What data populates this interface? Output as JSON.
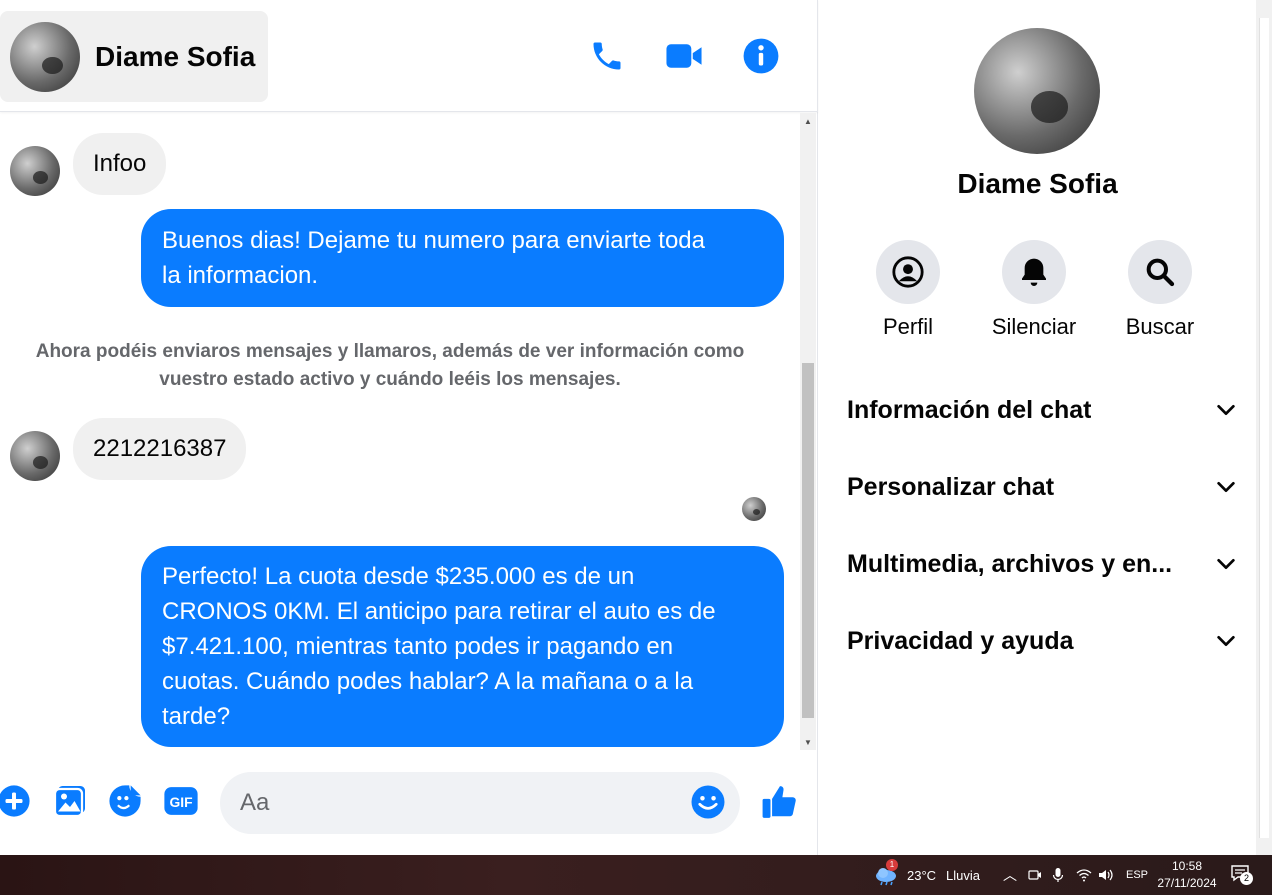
{
  "contact": {
    "name": "Diame Sofia"
  },
  "messages": [
    {
      "direction": "in",
      "text": "Infoo"
    },
    {
      "direction": "out",
      "lines": [
        "Buenos dias! Dejame tu numero para enviarte toda",
        "la informacion."
      ]
    },
    {
      "direction": "system",
      "lines": [
        "Ahora podéis enviaros mensajes y llamaros, además de ver información como",
        "vuestro estado activo y cuándo leéis los mensajes."
      ]
    },
    {
      "direction": "in",
      "text": "2212216387"
    },
    {
      "direction": "out",
      "lines": [
        "Perfecto! La cuota desde $235.000 es de un",
        "CRONOS 0KM. El anticipo para retirar el auto es de",
        "$7.421.100, mientras tanto podes ir pagando en",
        "cuotas. Cuándo podes hablar? A la mañana o a la",
        "tarde?"
      ]
    }
  ],
  "composer": {
    "placeholder": "Aa",
    "value": ""
  },
  "info": {
    "name": "Diame Sofia",
    "actions": [
      {
        "label": "Perfil"
      },
      {
        "label": "Silenciar"
      },
      {
        "label": "Buscar"
      }
    ],
    "sections": [
      {
        "label": "Información del chat"
      },
      {
        "label": "Personalizar chat"
      },
      {
        "label": "Multimedia, archivos y en..."
      },
      {
        "label": "Privacidad y ayuda"
      }
    ]
  },
  "taskbar": {
    "weather": {
      "temp": "23°C",
      "condition": "Lluvia",
      "badge": "1"
    },
    "language": "ESP",
    "time": "10:58",
    "date": "27/11/2024",
    "notifications": "2"
  },
  "colors": {
    "accent": "#0a7cff",
    "bubble_in": "#f0f0f0",
    "muted": "#65676b"
  }
}
